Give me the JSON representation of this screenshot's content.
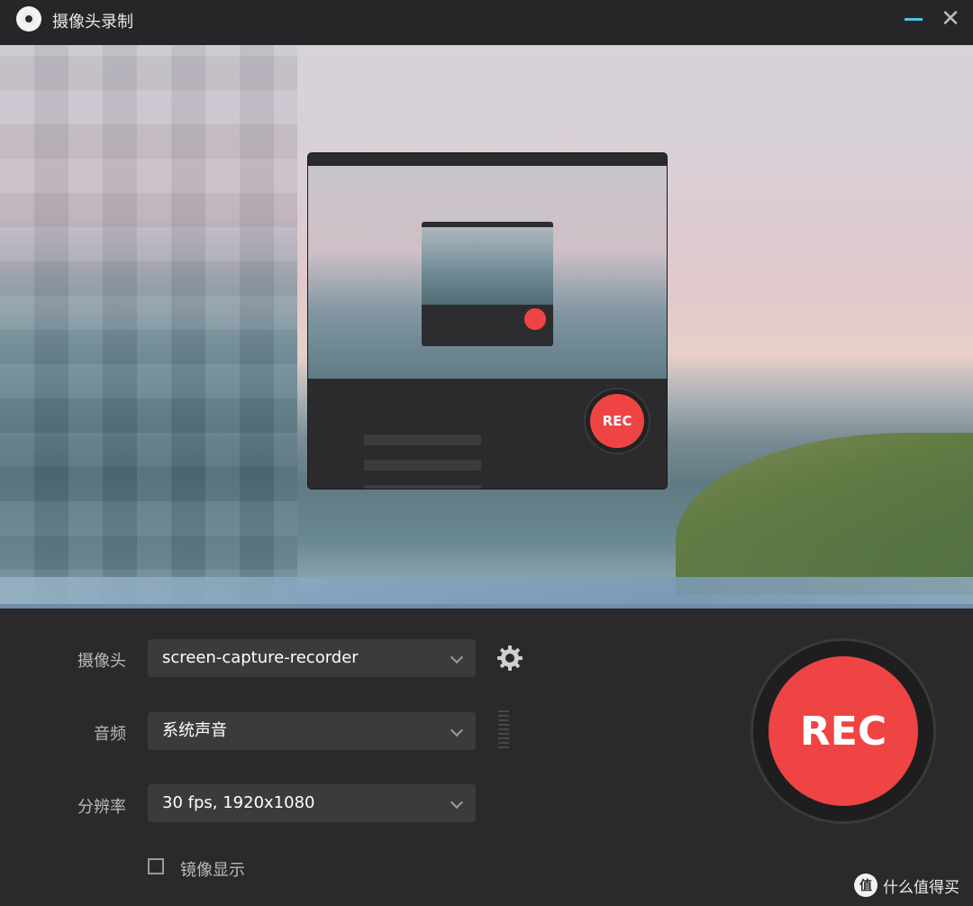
{
  "window": {
    "title": "摄像头录制",
    "minimize_icon": "minimize-icon",
    "close_icon": "close-icon",
    "close_glyph": "✕"
  },
  "controls": {
    "camera": {
      "label": "摄像头",
      "value": "screen-capture-recorder"
    },
    "audio": {
      "label": "音频",
      "value": "系统声音"
    },
    "resolution": {
      "label": "分辨率",
      "value": "30 fps, 1920x1080"
    },
    "mirror": {
      "label": "镜像显示",
      "checked": false
    }
  },
  "record": {
    "label": "REC",
    "color": "#ef4444"
  },
  "nested_preview": {
    "rec_label": "REC"
  },
  "watermark": {
    "logo": "值",
    "text": "什么值得买"
  },
  "colors": {
    "background": "#2a2a2c",
    "field": "#3b3b3e",
    "accent": "#4fc3e8",
    "record": "#ef4444"
  }
}
